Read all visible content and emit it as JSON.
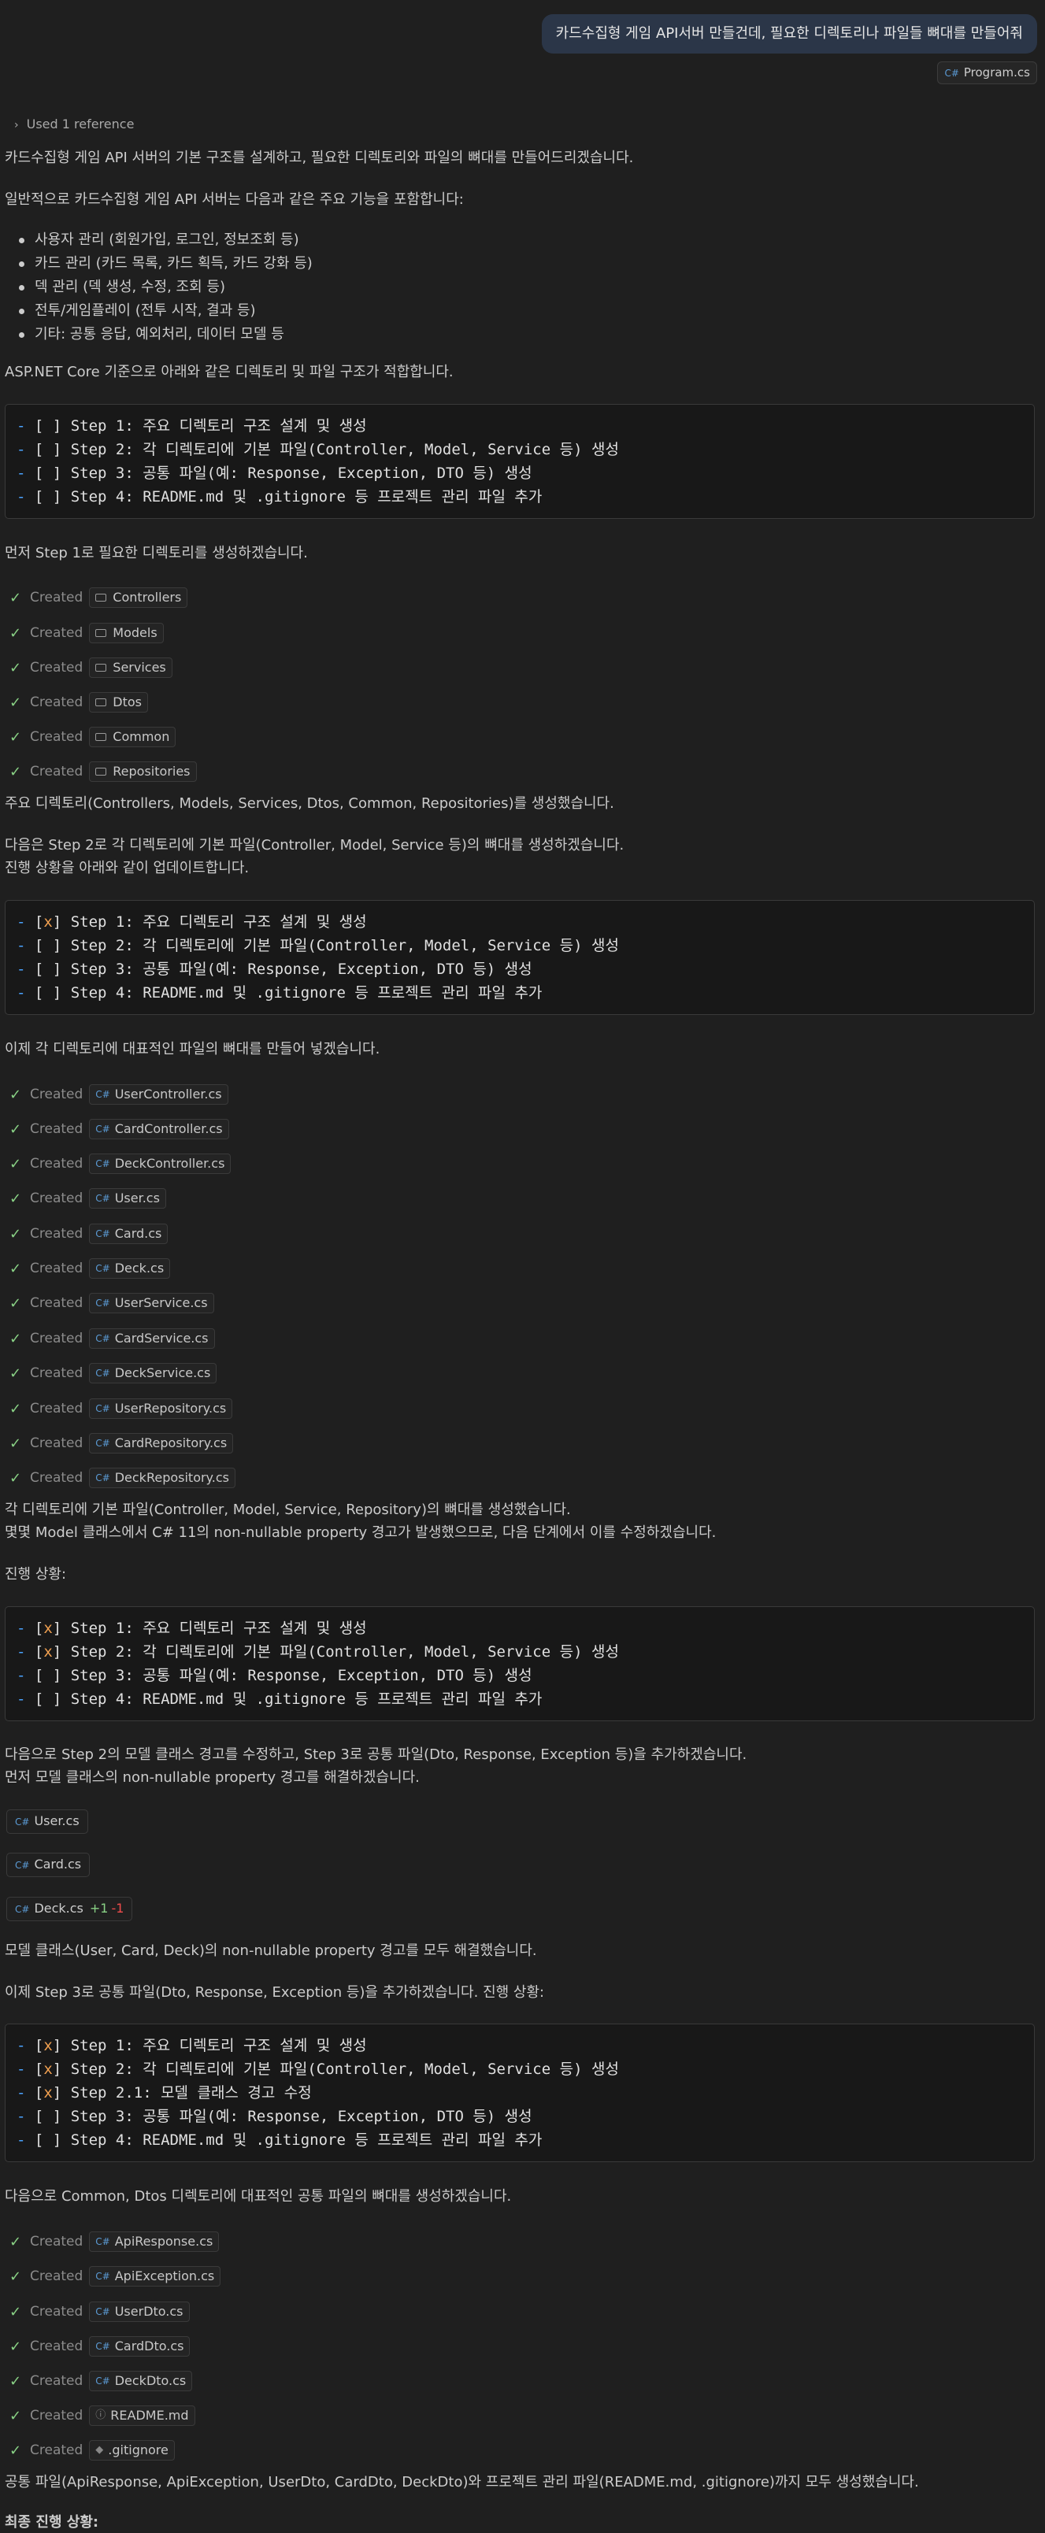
{
  "user_message": {
    "text": "카드수집형 게임 API서버 만들건데, 필요한 디렉토리나 파일들 뼈대를 만들어줘",
    "reference_file": "Program.cs"
  },
  "used_reference": "Used 1 reference",
  "intro": [
    "카드수집형 게임 API 서버의 기본 구조를 설계하고, 필요한 디렉토리와 파일의 뼈대를 만들어드리겠습니다.",
    "일반적으로 카드수집형 게임 API 서버는 다음과 같은 주요 기능을 포함합니다:"
  ],
  "features": [
    "사용자 관리 (회원가입, 로그인, 정보조회 등)",
    "카드 관리 (카드 목록, 카드 획득, 카드 강화 등)",
    "덱 관리 (덱 생성, 수정, 조회 등)",
    "전투/게임플레이 (전투 시작, 결과 등)",
    "기타: 공통 응답, 예외처리, 데이터 모델 등"
  ],
  "aspnet_note": "ASP.NET Core 기준으로 아래와 같은 디렉토리 및 파일 구조가 적합합니다.",
  "checklist1": [
    {
      "mark": " ",
      "text": "Step 1: 주요 디렉토리 구조 설계 및 생성"
    },
    {
      "mark": " ",
      "text": "Step 2: 각 디렉토리에 기본 파일(Controller, Model, Service 등) 생성"
    },
    {
      "mark": " ",
      "text": "Step 3: 공통 파일(예: Response, Exception, DTO 등) 생성"
    },
    {
      "mark": " ",
      "text": "Step 4: README.md 및 .gitignore 등 프로젝트 관리 파일 추가"
    }
  ],
  "step1_intro": "먼저 Step 1로 필요한 디렉토리를 생성하겠습니다.",
  "created_label": "Created",
  "dirs": [
    "Controllers",
    "Models",
    "Services",
    "Dtos",
    "Common",
    "Repositories"
  ],
  "dirs_done": "주요 디렉토리(Controllers, Models, Services, Dtos, Common, Repositories)를 생성했습니다.",
  "step2_intro": [
    "다음은 Step 2로 각 디렉토리에 기본 파일(Controller, Model, Service 등)의 뼈대를 생성하겠습니다.",
    "진행 상황을 아래와 같이 업데이트합니다."
  ],
  "checklist2": [
    {
      "mark": "x",
      "text": "Step 1: 주요 디렉토리 구조 설계 및 생성"
    },
    {
      "mark": " ",
      "text": "Step 2: 각 디렉토리에 기본 파일(Controller, Model, Service 등) 생성"
    },
    {
      "mark": " ",
      "text": "Step 3: 공통 파일(예: Response, Exception, DTO 등) 생성"
    },
    {
      "mark": " ",
      "text": "Step 4: README.md 및 .gitignore 등 프로젝트 관리 파일 추가"
    }
  ],
  "files_intro": "이제 각 디렉토리에 대표적인 파일의 뼈대를 만들어 넣겠습니다.",
  "files": [
    "UserController.cs",
    "CardController.cs",
    "DeckController.cs",
    "User.cs",
    "Card.cs",
    "Deck.cs",
    "UserService.cs",
    "CardService.cs",
    "DeckService.cs",
    "UserRepository.cs",
    "CardRepository.cs",
    "DeckRepository.cs"
  ],
  "files_done": [
    "각 디렉토리에 기본 파일(Controller, Model, Service, Repository)의 뼈대를 생성했습니다.",
    "몇몇 Model 클래스에서 C# 11의 non-nullable property 경고가 발생했으므로, 다음 단계에서 이를 수정하겠습니다."
  ],
  "progress_label": "진행 상황:",
  "checklist3": [
    {
      "mark": "x",
      "text": "Step 1: 주요 디렉토리 구조 설계 및 생성"
    },
    {
      "mark": "x",
      "text": "Step 2: 각 디렉토리에 기본 파일(Controller, Model, Service 등) 생성"
    },
    {
      "mark": " ",
      "text": "Step 3: 공통 파일(예: Response, Exception, DTO 등) 생성"
    },
    {
      "mark": " ",
      "text": "Step 4: README.md 및 .gitignore 등 프로젝트 관리 파일 추가"
    }
  ],
  "fix_intro": [
    "다음으로 Step 2의 모델 클래스 경고를 수정하고, Step 3로 공통 파일(Dto, Response, Exception 등)을 추가하겠습니다.",
    "먼저 모델 클래스의 non-nullable property 경고를 해결하겠습니다."
  ],
  "edited_files": [
    {
      "name": "User.cs",
      "added": "",
      "removed": ""
    },
    {
      "name": "Card.cs",
      "added": "",
      "removed": ""
    },
    {
      "name": "Deck.cs",
      "added": "+1",
      "removed": "-1"
    }
  ],
  "fix_done": "모델 클래스(User, Card, Deck)의 non-nullable property 경고를 모두 해결했습니다.",
  "step3_intro": "이제 Step 3로 공통 파일(Dto, Response, Exception 등)을 추가하겠습니다. 진행 상황:",
  "checklist4": [
    {
      "mark": "x",
      "text": "Step 1: 주요 디렉토리 구조 설계 및 생성"
    },
    {
      "mark": "x",
      "text": "Step 2: 각 디렉토리에 기본 파일(Controller, Model, Service 등) 생성"
    },
    {
      "mark": "x",
      "text": "Step 2.1: 모델 클래스 경고 수정"
    },
    {
      "mark": " ",
      "text": "Step 3: 공통 파일(예: Response, Exception, DTO 등) 생성"
    },
    {
      "mark": " ",
      "text": "Step 4: README.md 및 .gitignore 등 프로젝트 관리 파일 추가"
    }
  ],
  "common_intro": "다음으로 Common, Dtos 디렉토리에 대표적인 공통 파일의 뼈대를 생성하겠습니다.",
  "common_files": [
    "ApiResponse.cs",
    "ApiException.cs",
    "UserDto.cs",
    "CardDto.cs",
    "DeckDto.cs",
    "README.md",
    ".gitignore"
  ],
  "common_done": "공통 파일(ApiResponse, ApiException, UserDto, CardDto, DeckDto)와 프로젝트 관리 파일(README.md, .gitignore)까지 모두 생성했습니다.",
  "final_progress": "최종 진행 상황:"
}
